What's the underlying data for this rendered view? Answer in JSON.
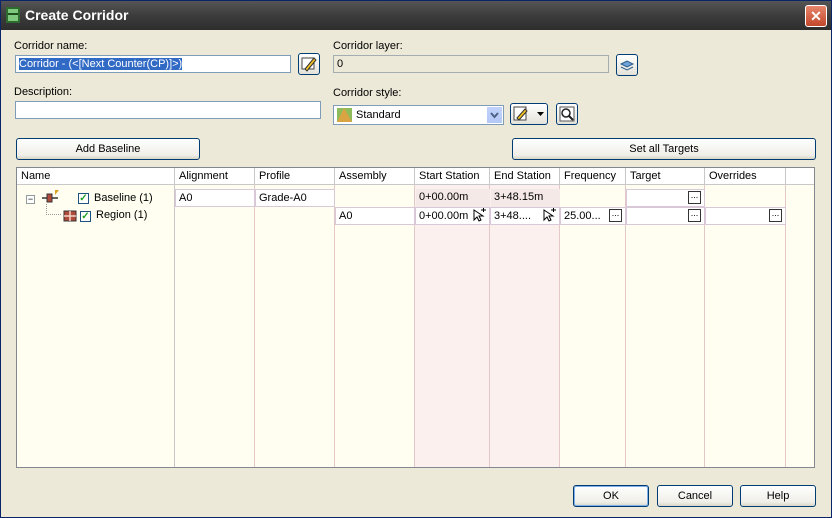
{
  "window": {
    "title": "Create Corridor"
  },
  "form": {
    "corridor_name_label": "Corridor name:",
    "corridor_name_value": "Corridor - (<[Next Counter(CP)]>)",
    "corridor_layer_label": "Corridor layer:",
    "corridor_layer_value": "0",
    "description_label": "Description:",
    "description_value": "",
    "corridor_style_label": "Corridor style:",
    "corridor_style_value": "Standard"
  },
  "buttons": {
    "add_baseline": "Add Baseline",
    "set_all_targets": "Set all Targets",
    "ok": "OK",
    "cancel": "Cancel",
    "help": "Help"
  },
  "grid": {
    "columns": [
      "Name",
      "Alignment",
      "Profile",
      "Assembly",
      "Start Station",
      "End Station",
      "Frequency",
      "Target",
      "Overrides"
    ],
    "rows": [
      {
        "name": "Baseline (1)",
        "alignment": "A0",
        "profile": "Grade-A0",
        "assembly": "",
        "start_station": "0+00.00m",
        "end_station": "3+48.15m",
        "frequency": "",
        "checked": true
      },
      {
        "name": "Region (1)",
        "alignment": "",
        "profile": "",
        "assembly": "A0",
        "start_station": "0+00.00m",
        "end_station": "3+48....",
        "frequency": "25.00...",
        "checked": true
      }
    ]
  },
  "colors": {
    "titlebar": "#3c3c3c",
    "dialog_bg": "#ece9d8",
    "grid_bg": "#fffef0",
    "selection": "#316ac5",
    "close_button": "#c1462b"
  }
}
